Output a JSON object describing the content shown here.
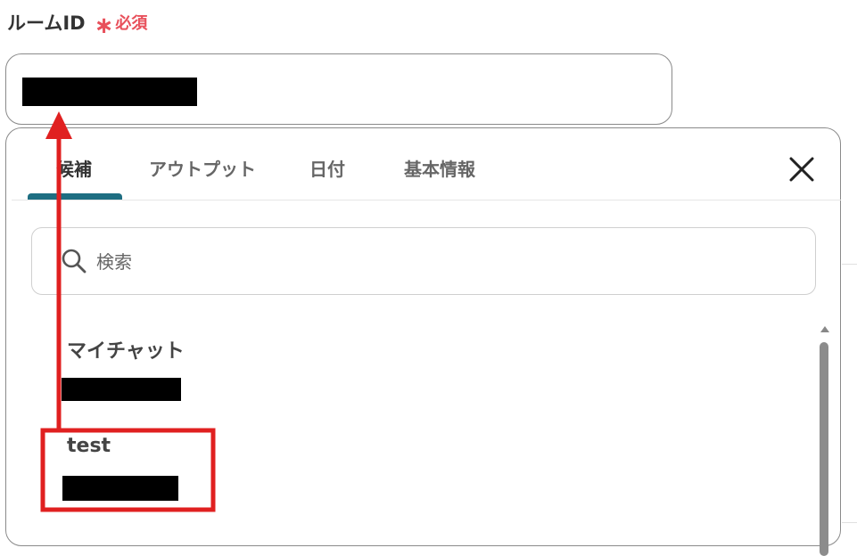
{
  "field": {
    "label": "ルームID",
    "required_star": "∗",
    "required_text": "必須"
  },
  "tabs": [
    {
      "label": "候補",
      "active": true
    },
    {
      "label": "アウトプット",
      "active": false
    },
    {
      "label": "日付",
      "active": false
    },
    {
      "label": "基本情報",
      "active": false
    }
  ],
  "search": {
    "placeholder": "検索",
    "value": ""
  },
  "list": {
    "items": [
      {
        "name": "マイチャット"
      },
      {
        "name": "test"
      }
    ]
  },
  "colors": {
    "accent": "#1e6e82",
    "required": "#e8505b",
    "annotation": "#e02020"
  },
  "icons": {
    "close": "close-icon",
    "search": "search-icon",
    "scroll_up": "chevron-up-icon"
  }
}
